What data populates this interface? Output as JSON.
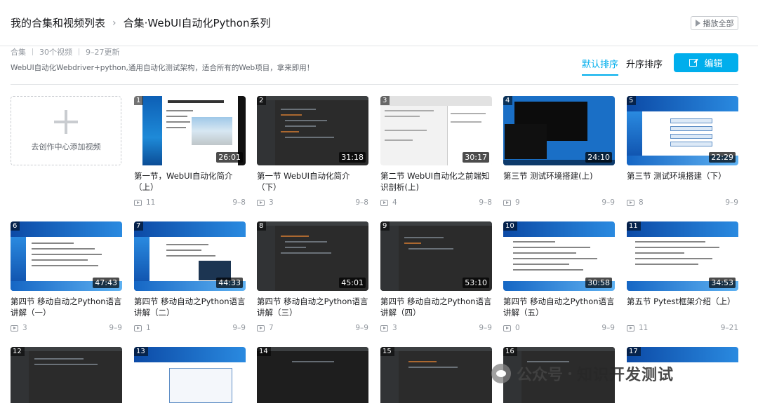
{
  "header": {
    "breadcrumb_root": "我的合集和视频列表",
    "breadcrumb_separator": "›",
    "breadcrumb_current": "合集·WebUI自动化Python系列",
    "play_all_label": "播放全部"
  },
  "collection": {
    "type_label": "合集",
    "video_count": "30个视频",
    "updated": "9–27更新",
    "description": "WebUI自动化Webdriver+python,通用自动化测试架构，适合所有的Web项目，拿来即用！"
  },
  "toolbar": {
    "sort_default": "默认排序",
    "sort_ascending": "升序排序",
    "edit_label": "编辑"
  },
  "add_card": {
    "label": "去创作中心添加视频"
  },
  "videos": [
    {
      "index": "1",
      "duration": "26:01",
      "title": "第一节，WebUI自动化简介（上）",
      "plays": "11",
      "date": "9–8"
    },
    {
      "index": "2",
      "duration": "31:18",
      "title": "第一节 WebUI自动化简介（下）",
      "plays": "3",
      "date": "9–8"
    },
    {
      "index": "3",
      "duration": "30:17",
      "title": "第二节 WebUI自动化之前端知识剖析(上)",
      "plays": "4",
      "date": "9–8"
    },
    {
      "index": "4",
      "duration": "24:10",
      "title": "第三节 测试环境搭建(上)",
      "plays": "9",
      "date": "9–9"
    },
    {
      "index": "5",
      "duration": "22:29",
      "title": "第三节 测试环境搭建（下）",
      "plays": "8",
      "date": "9–9"
    },
    {
      "index": "6",
      "duration": "47:43",
      "title": "第四节 移动自动之Python语言讲解（一）",
      "plays": "3",
      "date": "9–9"
    },
    {
      "index": "7",
      "duration": "44:33",
      "title": "第四节 移动自动之Python语言讲解（二）",
      "plays": "1",
      "date": "9–9"
    },
    {
      "index": "8",
      "duration": "45:01",
      "title": "第四节 移动自动之Python语言讲解（三）",
      "plays": "7",
      "date": "9–9"
    },
    {
      "index": "9",
      "duration": "53:10",
      "title": "第四节 移动自动之Python语言讲解（四）",
      "plays": "3",
      "date": "9–9"
    },
    {
      "index": "10",
      "duration": "30:58",
      "title": "第四节 移动自动之Python语言讲解（五）",
      "plays": "0",
      "date": "9–9"
    },
    {
      "index": "11",
      "duration": "34:53",
      "title": "第五节 Pytest框架介绍（上）",
      "plays": "11",
      "date": "9–21"
    },
    {
      "index": "12"
    },
    {
      "index": "13"
    },
    {
      "index": "14"
    },
    {
      "index": "15"
    },
    {
      "index": "16"
    },
    {
      "index": "17"
    }
  ],
  "watermark": {
    "label1": "公众号",
    "label2": "知识开发测试"
  },
  "colors": {
    "accent": "#00aeec",
    "text": "#18191c",
    "muted": "#9499a0"
  }
}
